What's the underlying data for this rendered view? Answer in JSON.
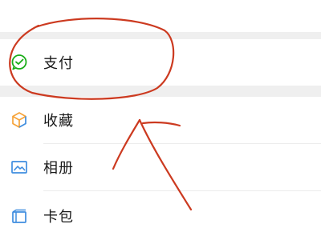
{
  "menu": {
    "items": [
      {
        "id": "pay",
        "label": "支付",
        "icon": "wechat-pay-icon"
      },
      {
        "id": "favorites",
        "label": "收藏",
        "icon": "favorites-cube-icon"
      },
      {
        "id": "album",
        "label": "相册",
        "icon": "album-picture-icon"
      },
      {
        "id": "cards",
        "label": "卡包",
        "icon": "card-wallet-icon"
      }
    ]
  },
  "colors": {
    "annotation_ink": "#cc3a20",
    "pay_green": "#1aad19",
    "favorites_orange": "#f7a43a",
    "favorites_blue": "#3f8ddf",
    "album_blue": "#3f8ddf",
    "cards_blue": "#3f8ddf",
    "section_gap": "#efefef"
  }
}
